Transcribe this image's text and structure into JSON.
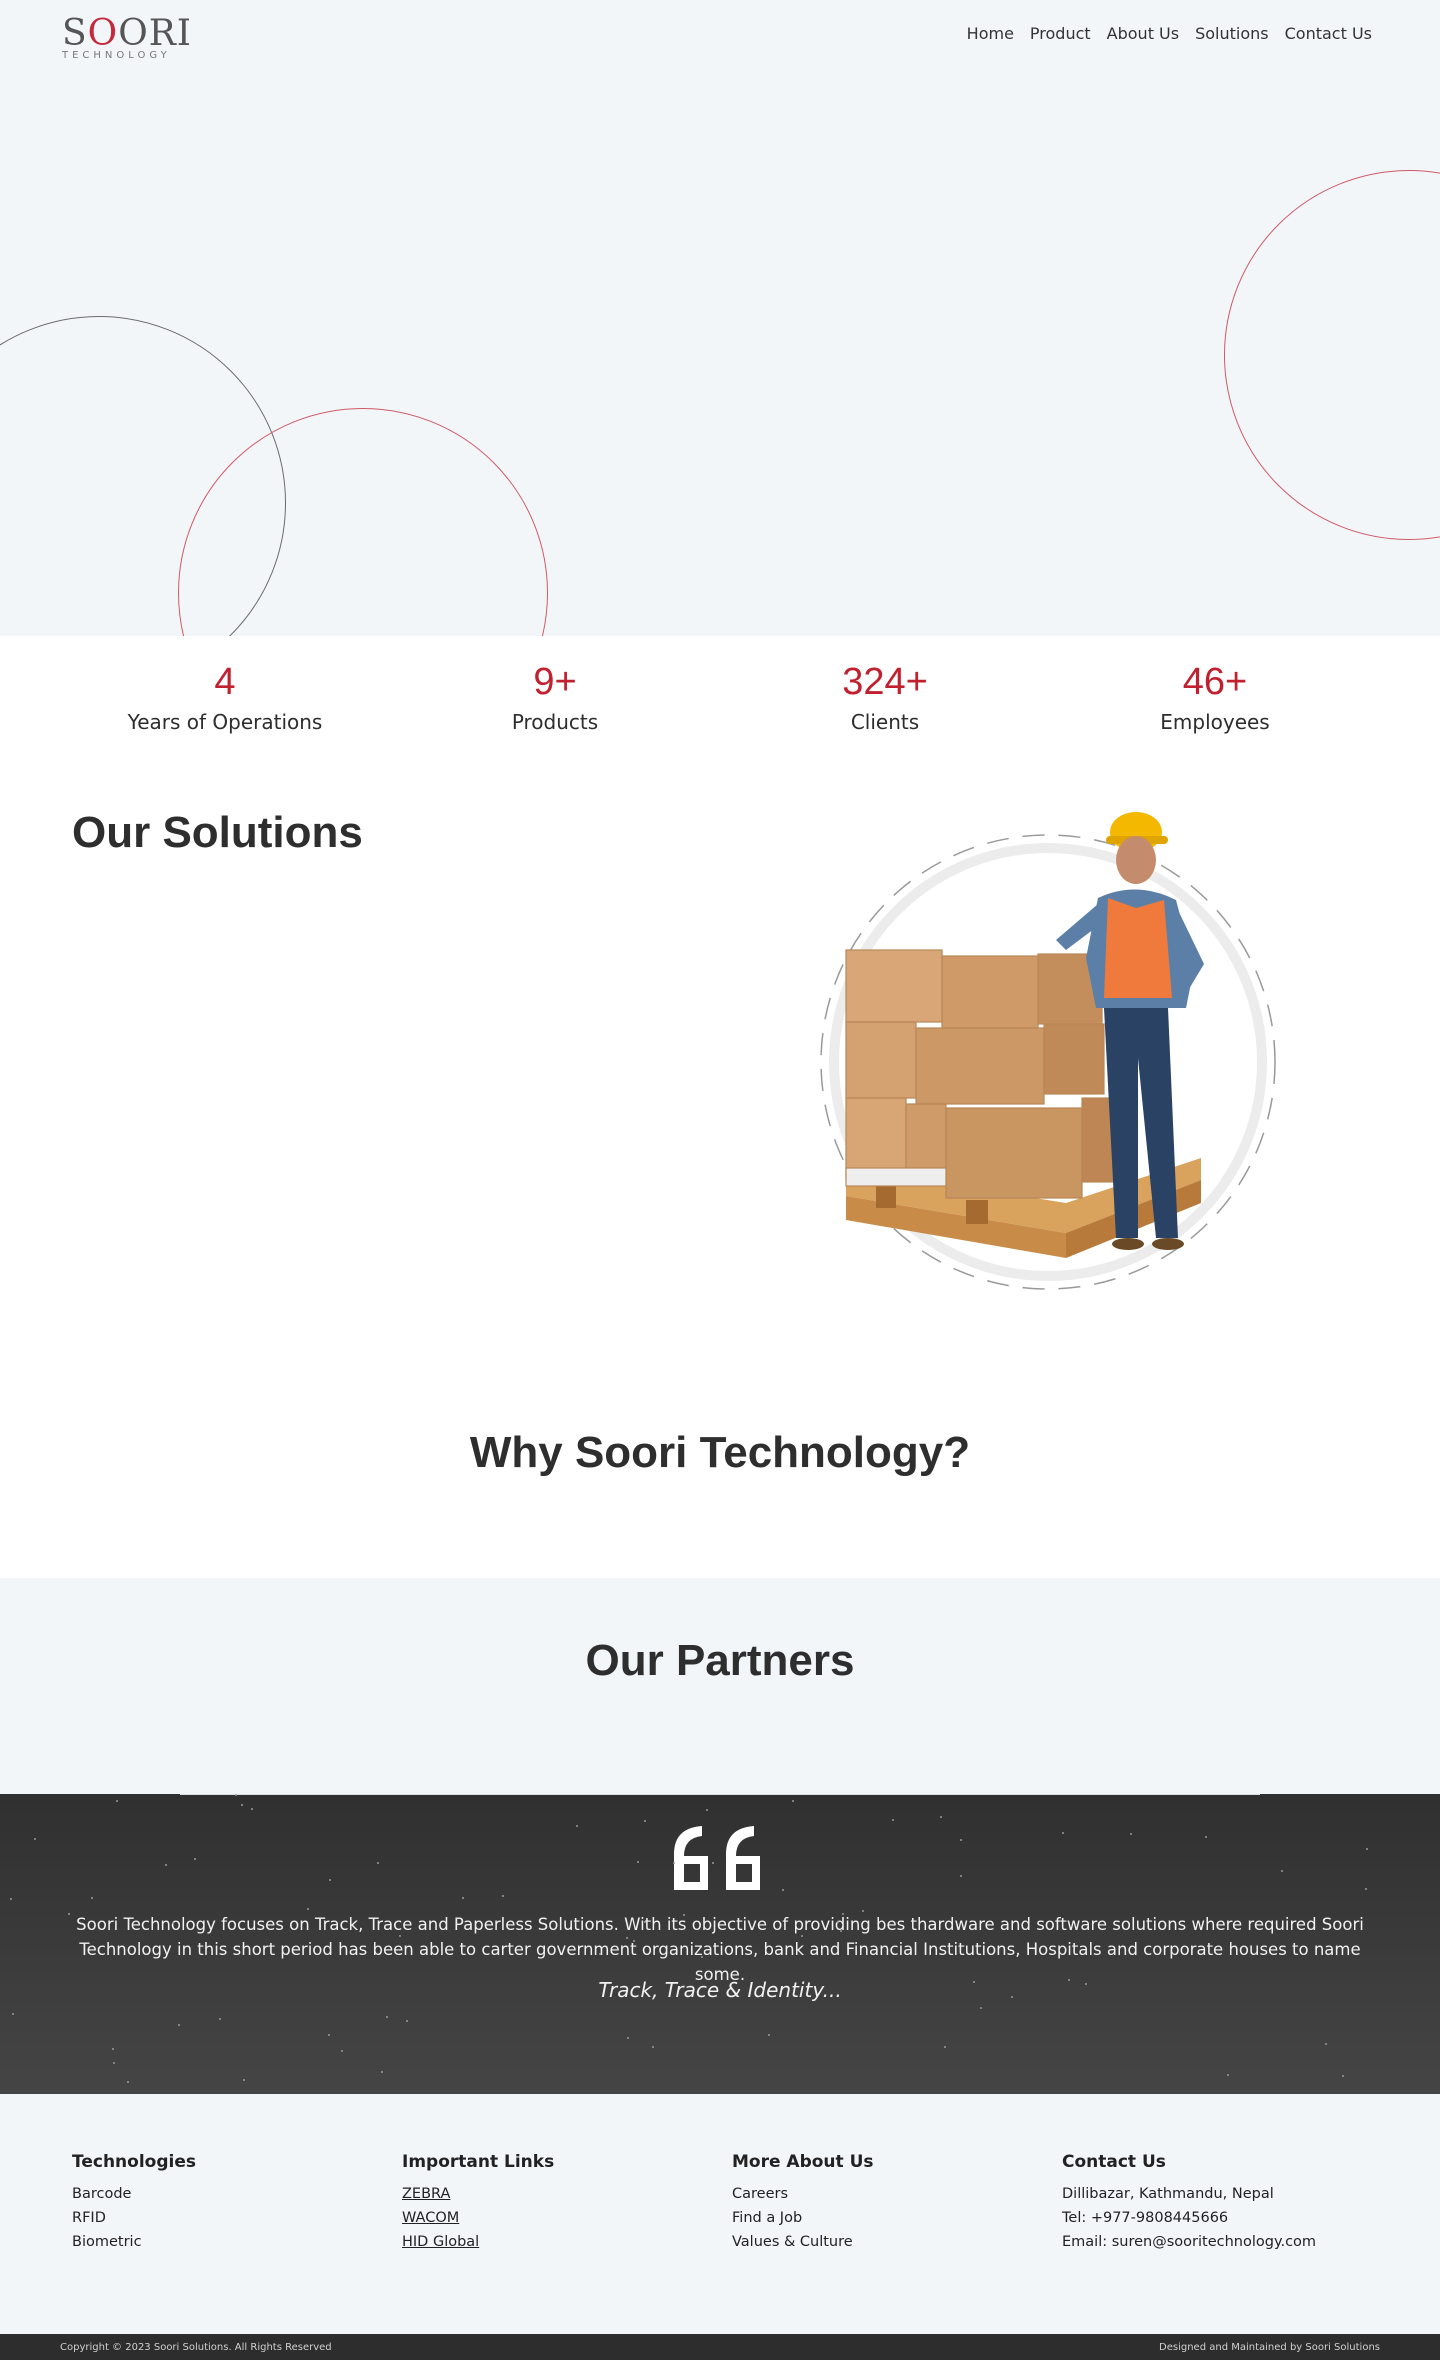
{
  "brand": {
    "name_a": "S",
    "name_o": "O",
    "name_b": "ORI",
    "tagline": "TECHNOLOGY",
    "accent": "#c1202f"
  },
  "nav": [
    "Home",
    "Product",
    "About Us",
    "Solutions",
    "Contact Us"
  ],
  "stats": [
    {
      "value": "4",
      "label": "Years of Operations"
    },
    {
      "value": "9+",
      "label": "Products"
    },
    {
      "value": "324+",
      "label": "Clients"
    },
    {
      "value": "46+",
      "label": "Employees"
    }
  ],
  "solutions": {
    "title": "Our Solutions",
    "image": "worker-with-boxes-illustration"
  },
  "why": {
    "title": "Why Soori Technology?"
  },
  "partners": {
    "title": "Our Partners"
  },
  "quote": {
    "icon": "quote-icon",
    "text": "Soori Technology focuses on Track, Trace and Paperless Solutions. With its objective of providing bes thardware and software solutions where required Soori Technology in this short period has been able to carter government organizations, bank and Financial Institutions, Hospitals and corporate houses to name some.",
    "tagline": "Track, Trace & Identity..."
  },
  "footer": {
    "technologies": {
      "title": "Technologies",
      "items": [
        "Barcode",
        "RFID",
        "Biometric"
      ]
    },
    "links": {
      "title": "Important Links",
      "items": [
        "ZEBRA",
        "WACOM",
        "HID Global"
      ]
    },
    "more": {
      "title": "More About Us",
      "items": [
        "Careers",
        "Find a Job",
        "Values & Culture"
      ]
    },
    "contact": {
      "title": "Contact Us",
      "items": [
        "Dillibazar, Kathmandu, Nepal",
        "Tel: +977-9808445666",
        "Email: suren@sooritechnology.com"
      ]
    }
  },
  "copyright": {
    "left": "Copyright © 2023 Soori Solutions. All Rights Reserved",
    "right": "Designed and Maintained by Soori Solutions"
  }
}
